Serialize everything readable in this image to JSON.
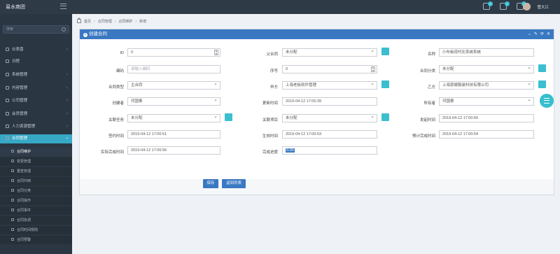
{
  "header": {
    "brand": "易水商团",
    "user": "管大江",
    "badges": [
      "5",
      "1",
      "0"
    ]
  },
  "sidebar": {
    "search_placeholder": "搜索",
    "items": [
      {
        "label": "仪表盘"
      },
      {
        "label": "日程"
      },
      {
        "label": "系统管理"
      },
      {
        "label": "内容管理"
      },
      {
        "label": "公司管理"
      },
      {
        "label": "会员管理"
      },
      {
        "label": "人力资源管理"
      },
      {
        "label": "合同管理"
      }
    ],
    "sub_items": [
      "合同维护",
      "变更管理",
      "重签管理",
      "合同归档",
      "合同分类",
      "合同操作",
      "合同事件",
      "合同协调",
      "合同时间规则",
      "合同预警"
    ]
  },
  "breadcrumb": [
    "首页",
    "合同管理",
    "合同维护",
    "新增"
  ],
  "panel": {
    "title": "创建合同",
    "tools": [
      "⌄",
      "✎",
      "⟳",
      "✕"
    ],
    "fields": {
      "id_label": "ID",
      "id_value": "0",
      "parent_label": "父合同",
      "parent_value": "未分配",
      "name_label": "名称",
      "name_value": "小布板现代化系统系统",
      "code_label": "编码",
      "code_placeholder": "请输入编码",
      "seq_label": "序号",
      "seq_value": "0",
      "category_label": "合同分类",
      "category_value": "未分配",
      "type_label": "合同类型",
      "type_value": "主合同",
      "party_a_label": "甲方",
      "party_a_value": "上海老板软件管理",
      "party_b_label": "乙方",
      "party_b_value": "上海恩健服装科技有限公司",
      "creator_label": "创建者",
      "creator_value": "邓国泰",
      "update_label": "更新时间",
      "update_value": "2019-04-12 17:00:39",
      "owner_label": "所有者",
      "owner_value": "邓国泰",
      "task_label": "关联任务",
      "task_value": "未分配",
      "project_label": "关联项目",
      "project_value": "未分配",
      "publish_label": "发起时间",
      "publish_value": "2019-04-12 17:00:50",
      "sign_label": "签约时间",
      "sign_value": "2019-04-12 17:00:51",
      "effective_label": "生效时间",
      "effective_value": "2019-04-12 17:00:53",
      "expected_label": "预计完成时间",
      "expected_value": "2019-04-12 17:00:54",
      "actual_label": "实际完成时间",
      "actual_value": "2019-04-12 17:00:56",
      "progress_label": "完成进度",
      "progress_value": "0.00"
    },
    "buttons": {
      "save": "保存",
      "back": "返回列表"
    }
  },
  "colors": {
    "header": "#3a78c2",
    "accent": "#3bbfcf",
    "sidebar": "#2b3643"
  }
}
